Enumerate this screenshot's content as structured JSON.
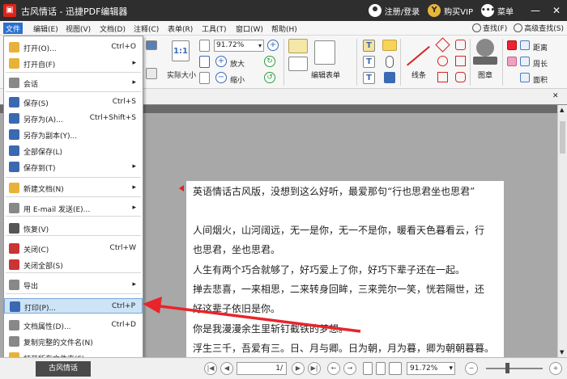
{
  "titlebar": {
    "app_title": "古风情话 - 迅捷PDF编辑器",
    "login": "注册/登录",
    "vip": "购买VIP",
    "menu": "菜单",
    "minimize": "—",
    "close": "✕"
  },
  "menubar": {
    "items": [
      "文件",
      "编辑(E)",
      "视图(V)",
      "文档(D)",
      "注释(C)",
      "表单(R)",
      "工具(T)",
      "窗口(W)",
      "帮助(H)"
    ],
    "find": "查找(F)",
    "advanced_find": "高级查找(S)"
  },
  "toolbar": {
    "zoom_value": "91.72%",
    "actual_size": "实际大小",
    "zoom_in": "放大",
    "zoom_out": "缩小",
    "edit_form": "编辑表单",
    "line": "线条",
    "stamp": "图章",
    "distance": "距离",
    "perimeter": "周长",
    "area": "面积"
  },
  "file_menu": {
    "items": [
      {
        "label": "打开(O)...",
        "shortcut": "Ctrl+O",
        "submenu": false,
        "icon_color": "#e8b23a"
      },
      {
        "label": "打开自(F)",
        "shortcut": "",
        "submenu": true,
        "icon_color": "#e8b23a"
      },
      {
        "label": "会话",
        "shortcut": "",
        "submenu": true,
        "icon_color": "#888888"
      },
      {
        "label": "保存(S)",
        "shortcut": "Ctrl+S",
        "submenu": false,
        "icon_color": "#3b68b3"
      },
      {
        "label": "另存为(A)...",
        "shortcut": "Ctrl+Shift+S",
        "submenu": false,
        "icon_color": "#3b68b3"
      },
      {
        "label": "另存为副本(Y)...",
        "shortcut": "",
        "submenu": false,
        "icon_color": "#3b68b3"
      },
      {
        "label": "全部保存(L)",
        "shortcut": "",
        "submenu": false,
        "icon_color": "#3b68b3"
      },
      {
        "label": "保存到(T)",
        "shortcut": "",
        "submenu": true,
        "icon_color": "#3b68b3"
      },
      {
        "label": "新建文档(N)",
        "shortcut": "",
        "submenu": true,
        "icon_color": "#e8b23a"
      },
      {
        "label": "用 E-mail 发送(E)...",
        "shortcut": "",
        "submenu": true,
        "icon_color": "#888888"
      },
      {
        "label": "恢复(V)",
        "shortcut": "",
        "submenu": false,
        "icon_color": "#555555"
      },
      {
        "label": "关闭(C)",
        "shortcut": "Ctrl+W",
        "submenu": false,
        "icon_color": "#cc3333"
      },
      {
        "label": "关闭全部(S)",
        "shortcut": "",
        "submenu": false,
        "icon_color": "#cc3333"
      },
      {
        "label": "导出",
        "shortcut": "",
        "submenu": true,
        "icon_color": "#888888"
      },
      {
        "label": "打印(P)...",
        "shortcut": "Ctrl+P",
        "submenu": false,
        "icon_color": "#3b68b3"
      },
      {
        "label": "文档属性(D)...",
        "shortcut": "Ctrl+D",
        "submenu": false,
        "icon_color": "#888888"
      },
      {
        "label": "复制完整的文件名(N)",
        "shortcut": "",
        "submenu": false,
        "icon_color": "#888888"
      },
      {
        "label": "打开所在文件夹(F)...",
        "shortcut": "",
        "submenu": false,
        "icon_color": "#e8b23a"
      }
    ]
  },
  "document": {
    "lines": [
      "英语情话古风版，没想到这么好听，最爱那句“行也思君坐也思君”",
      "人间烟火，山河阔远，无一是你，无一不是你，暖看天色暮看云，行",
      "也思君，坐也思君。",
      "人生有两个巧合就够了，好巧爱上了你，好巧下辈子还在一起。",
      "掸去悲喜，一来相思，二来转身回眸，三来莞尔一笑，恍若隔世，还",
      "好这辈子依旧是你。",
      "你是我漫漫余生里斩钉截铁的梦想。",
      "浮生三千，吾爱有三。日、月与卿。日为朝，月为暮，卿为朝朝暮暮。"
    ]
  },
  "statusbar": {
    "tab": "古风情话",
    "page": "1/",
    "zoom": "91.72%"
  }
}
